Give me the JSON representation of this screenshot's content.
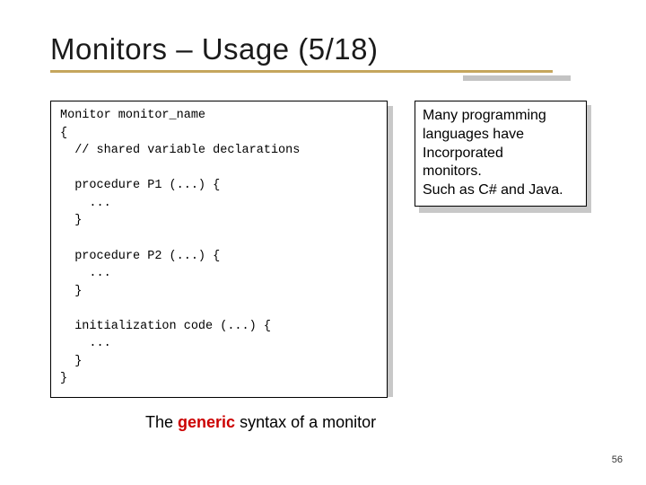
{
  "title": "Monitors – Usage (5/18)",
  "code": "Monitor monitor_name\n{\n  // shared variable declarations\n\n  procedure P1 (...) {\n    ...\n  }\n\n  procedure P2 (...) {\n    ...\n  }\n\n  initialization code (...) {\n    ...\n  }\n}",
  "info": {
    "l1": "Many programming",
    "l2": "languages have",
    "l3": "Incorporated",
    "l4": "monitors.",
    "l5": "Such as C# and Java."
  },
  "caption": {
    "pre": "The ",
    "strong": "generic",
    "post": " syntax of a monitor"
  },
  "page": "56"
}
